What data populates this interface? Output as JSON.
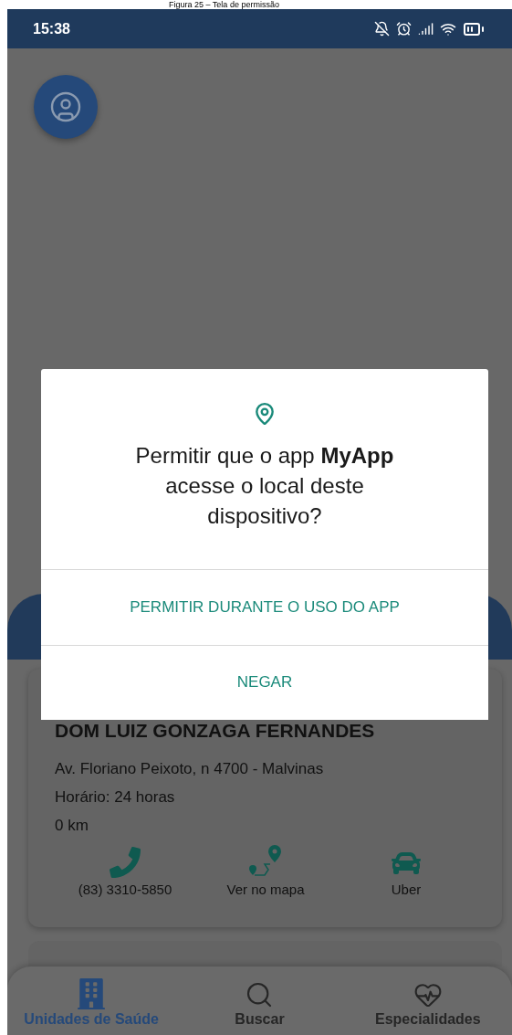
{
  "caption": "Figura 25 – Tela de permissão",
  "status_bar": {
    "time": "15:38"
  },
  "dialog": {
    "message": "Permitir que o app **MyApp** acesse o local deste dispositivo?",
    "buttons": [
      {
        "label": "PERMITIR DURANTE O USO DO APP"
      },
      {
        "label": "NEGAR"
      }
    ]
  },
  "card": {
    "name": "DOM LUIZ GONZAGA FERNANDES",
    "address": "Av. Floriano Peixoto, n 4700 - Malvinas",
    "hours": "Horário: 24 horas",
    "distance": "0 km",
    "actions": [
      {
        "kind": "phone",
        "label": "(83) 3310-5850"
      },
      {
        "kind": "map",
        "label": "Ver no mapa"
      },
      {
        "kind": "car",
        "label": "Uber"
      }
    ]
  },
  "bottom_nav": [
    {
      "kind": "units",
      "label": "Unidades de Saúde",
      "selected": true
    },
    {
      "kind": "search",
      "label": "Buscar",
      "selected": false
    },
    {
      "kind": "specialties",
      "label": "Especialidades",
      "selected": false
    }
  ]
}
